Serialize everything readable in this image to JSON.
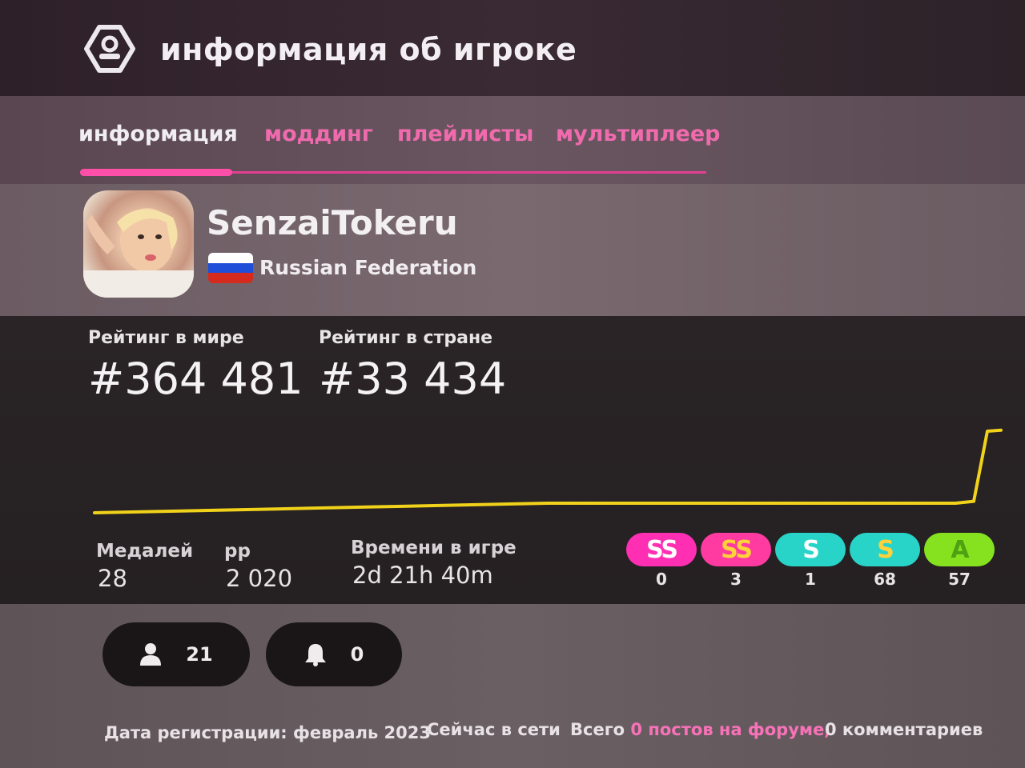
{
  "header": {
    "title": "информация об игроке",
    "icon": "user-badge-icon"
  },
  "tabs": [
    {
      "label": "информация",
      "active": true
    },
    {
      "label": "моддинг",
      "active": false
    },
    {
      "label": "плейлисты",
      "active": false
    },
    {
      "label": "мультиплеер",
      "active": false
    }
  ],
  "profile": {
    "username": "SenzaiTokeru",
    "country": "Russian Federation",
    "flag_colors": [
      "#ffffff",
      "#1f4fd8",
      "#d52b1e"
    ]
  },
  "ranks": {
    "global_label": "Рейтинг в мире",
    "global_value": "#364 481",
    "country_label": "Рейтинг в стране",
    "country_value": "#33 434"
  },
  "stats": {
    "medals_label": "Медалей",
    "medals_value": "28",
    "pp_label": "pp",
    "pp_value": "2 020",
    "playtime_label": "Времени в игре",
    "playtime_value": "2d 21h 40m"
  },
  "grades": [
    {
      "label": "SS",
      "count": "0",
      "color": "#ff2fb4",
      "text_color": "#ffffff"
    },
    {
      "label": "SS",
      "count": "3",
      "color": "#ff3aa0",
      "text_color": "#ffd23a"
    },
    {
      "label": "S",
      "count": "1",
      "color": "#28d4c8",
      "text_color": "#ffffff"
    },
    {
      "label": "S",
      "count": "68",
      "color": "#28d4c8",
      "text_color": "#ffd23a"
    },
    {
      "label": "A",
      "count": "57",
      "color": "#86e21e",
      "text_color": "#4fa012"
    }
  ],
  "chart_data": {
    "type": "line",
    "color": "#f0d21a",
    "values": [
      0,
      0.02,
      0.04,
      0.06,
      0.08,
      0.1,
      0.1,
      0.1,
      0.1,
      0.1,
      0.1,
      0.12,
      0.85,
      0.86
    ],
    "x": [
      0,
      0.1,
      0.2,
      0.3,
      0.4,
      0.5,
      0.6,
      0.7,
      0.8,
      0.9,
      0.95,
      0.97,
      0.985,
      1.0
    ]
  },
  "social": {
    "followers": "21",
    "followers_icon": "user-icon",
    "subscribers": "0",
    "subscribers_icon": "bell-icon"
  },
  "footer": {
    "joined": "Дата регистрации: февраль 2023",
    "online": "Сейчас в сети",
    "posts_prefix": "Всего",
    "posts_link": "0 постов на форуме,",
    "comments_link": "0 комментариев"
  }
}
